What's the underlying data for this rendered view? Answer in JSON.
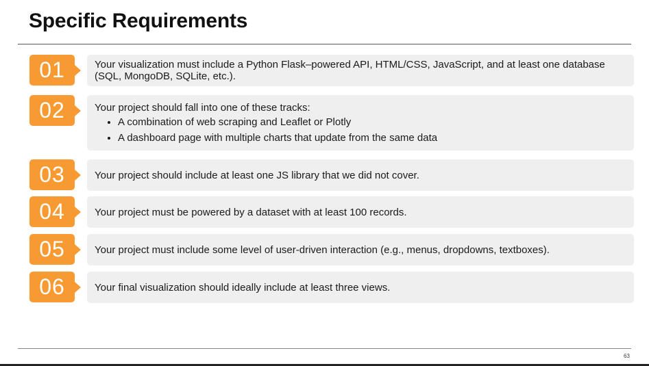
{
  "slide": {
    "title": "Specific Requirements",
    "page_number": "63"
  },
  "requirements": [
    {
      "number": "01",
      "text": "Your visualization must include a Python Flask–powered API, HTML/CSS, JavaScript, and at least one database (SQL, MongoDB, SQLite, etc.)."
    },
    {
      "number": "02",
      "text": "Your project should fall into one of these tracks:",
      "bullets": [
        "A combination of web scraping and Leaflet or Plotly",
        "A dashboard page with multiple charts that update from the same data"
      ]
    },
    {
      "number": "03",
      "text": "Your project should include at least one JS library that we did not cover."
    },
    {
      "number": "04",
      "text": "Your project must be powered by a dataset with at least 100 records."
    },
    {
      "number": "05",
      "text": "Your project must include some level of user-driven interaction (e.g., menus, dropdowns, textboxes)."
    },
    {
      "number": "06",
      "text": "Your final visualization should ideally include at least three views."
    }
  ],
  "colors": {
    "badge": "#f79a32",
    "text_box": "#efefef",
    "title": "#111111"
  }
}
